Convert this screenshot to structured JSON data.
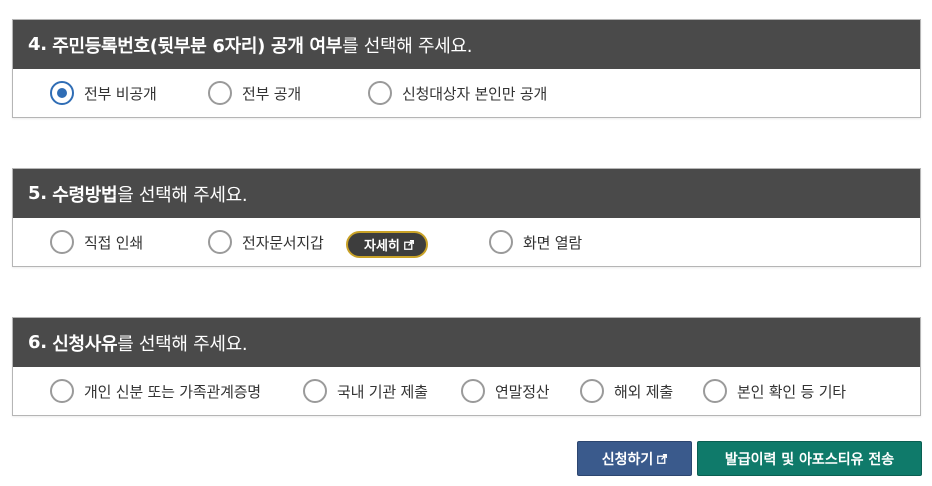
{
  "section4": {
    "num": "4.",
    "bold": "주민등록번호(뒷부분 6자리) 공개 여부",
    "rest": "를 선택해 주세요.",
    "options": [
      {
        "label": "전부 비공개",
        "checked": true
      },
      {
        "label": "전부 공개",
        "checked": false
      },
      {
        "label": "신청대상자 본인만 공개",
        "checked": false
      }
    ]
  },
  "section5": {
    "num": "5.",
    "bold": "수령방법",
    "rest": "을 선택해 주세요.",
    "options": [
      {
        "label": "직접 인쇄",
        "checked": false
      },
      {
        "label": "전자문서지갑",
        "checked": false
      },
      {
        "label": "화면 열람",
        "checked": false
      }
    ],
    "detail_button": "자세히"
  },
  "section6": {
    "num": "6.",
    "bold": "신청사유",
    "rest": "를 선택해 주세요.",
    "options": [
      {
        "label": "개인 신분 또는 가족관계증명",
        "checked": false
      },
      {
        "label": "국내 기관 제출",
        "checked": false
      },
      {
        "label": "연말정산",
        "checked": false
      },
      {
        "label": "해외 제출",
        "checked": false
      },
      {
        "label": "본인 확인 등 기타",
        "checked": false
      }
    ]
  },
  "actions": {
    "apply_label": "신청하기",
    "send_label": "발급이력 및 아포스티유 전송"
  },
  "colors": {
    "header_bg": "#4a4a4a",
    "radio_checked": "#2f6db5",
    "apply_bg": "#3a5a8c",
    "send_bg": "#0f7a6a",
    "detail_border": "#c9a227"
  },
  "icons": {
    "external_link": "external-link-icon"
  }
}
